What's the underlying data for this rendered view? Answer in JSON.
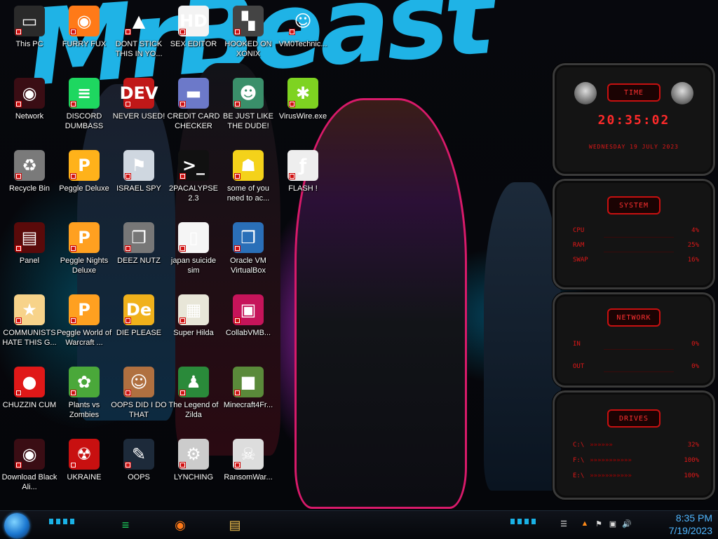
{
  "desktop": {
    "icons": [
      {
        "label": "This PC",
        "icon": "this-pc-icon",
        "bg": "#2a2a2a",
        "glyph": "▭"
      },
      {
        "label": "FURRY FUX",
        "icon": "firefox-icon",
        "bg": "#ff7a18",
        "glyph": "◉"
      },
      {
        "label": "DONT STICK THIS IN YO...",
        "icon": "vlc-cone-icon",
        "bg": "#0000",
        "glyph": "▲"
      },
      {
        "label": "SEX EDITOR",
        "icon": "hex-editor-icon",
        "bg": "#f3f3f3",
        "glyph": "HD"
      },
      {
        "label": "HOOKED ON XONIX",
        "icon": "xonix-icon",
        "bg": "#444",
        "glyph": "▚"
      },
      {
        "label": "VM0Technic...",
        "icon": "technician-icon",
        "bg": "#0000",
        "glyph": "☺"
      },
      {
        "label": "Network",
        "icon": "network-icon",
        "bg": "#3a0d14",
        "glyph": "◉"
      },
      {
        "label": "DISCORD DUMBASS",
        "icon": "spotify-icon",
        "bg": "#1ed760",
        "glyph": "≡"
      },
      {
        "label": "NEVER USED!",
        "icon": "dev-cpp-icon",
        "bg": "#c01818",
        "glyph": "DEV"
      },
      {
        "label": "CREDIT CARD CHECKER",
        "icon": "credit-card-icon",
        "bg": "#6c79c9",
        "glyph": "▬"
      },
      {
        "label": "BE JUST LIKE THE DUDE!",
        "icon": "santa-icon",
        "bg": "#3a8f6a",
        "glyph": "☻"
      },
      {
        "label": "VirusWire.exe",
        "icon": "limewire-icon",
        "bg": "#7ed321",
        "glyph": "✱"
      },
      {
        "label": "Recycle Bin",
        "icon": "recycle-bin-icon",
        "bg": "#7a7a7a",
        "glyph": "♻"
      },
      {
        "label": "Peggle Deluxe",
        "icon": "peggle-icon",
        "bg": "#ffb21a",
        "glyph": "P"
      },
      {
        "label": "ISRAEL SPY",
        "icon": "spy-icon",
        "bg": "#cfd7e0",
        "glyph": "⚑"
      },
      {
        "label": "2PACALYPSE 2.3",
        "icon": "terminal-icon",
        "bg": "#111",
        "glyph": ">_"
      },
      {
        "label": "some of you need to ac...",
        "icon": "beaver-icon",
        "bg": "#f4d21a",
        "glyph": "☗"
      },
      {
        "label": "FLASH !",
        "icon": "flash-icon",
        "bg": "#eee",
        "glyph": "ƒ"
      },
      {
        "label": "Panel",
        "icon": "control-panel-icon",
        "bg": "#5a0a0a",
        "glyph": "▤"
      },
      {
        "label": "Peggle Nights Deluxe",
        "icon": "peggle-nights-icon",
        "bg": "#ffa020",
        "glyph": "P"
      },
      {
        "label": "DEEZ NUTZ",
        "icon": "folder-stack-icon",
        "bg": "#777",
        "glyph": "❐"
      },
      {
        "label": "japan suicide sim",
        "icon": "file-icon",
        "bg": "#f5f5f5",
        "glyph": "▯"
      },
      {
        "label": "Oracle VM VirtualBox",
        "icon": "virtualbox-icon",
        "bg": "#2a6fb8",
        "glyph": "❒"
      },
      {
        "label": "COMMUNISTS HATE THIS G...",
        "icon": "star-butterfly-icon",
        "bg": "#f7d38a",
        "glyph": "★"
      },
      {
        "label": "Peggle World of Warcraft ...",
        "icon": "peggle-wow-icon",
        "bg": "#ffa020",
        "glyph": "P"
      },
      {
        "label": "DIE PLEASE",
        "icon": "de-icon",
        "bg": "#f0b11b",
        "glyph": "De"
      },
      {
        "label": "Super Hilda",
        "icon": "pixel-dog-icon",
        "bg": "#e8e6d8",
        "glyph": "▦"
      },
      {
        "label": "CollabVMB...",
        "icon": "monitor-icon",
        "bg": "#c6145a",
        "glyph": "▣"
      },
      {
        "label": "CHUZZIN CUM",
        "icon": "chuzzle-icon",
        "bg": "#e01818",
        "glyph": "●"
      },
      {
        "label": "Plants vs Zombies",
        "icon": "pvz-icon",
        "bg": "#4aa83a",
        "glyph": "✿"
      },
      {
        "label": "OOPS DID I DO THAT",
        "icon": "portrait-icon",
        "bg": "#b07040",
        "glyph": "☺"
      },
      {
        "label": "The Legend of Zilda",
        "icon": "zelda-icon",
        "bg": "#2a8a3a",
        "glyph": "♟"
      },
      {
        "label": "Minecraft4Fr...",
        "icon": "minecraft-icon",
        "bg": "#5a8a3a",
        "glyph": "■"
      },
      {
        "label": "Download Black Ali...",
        "icon": "alien-icon",
        "bg": "#3a0d14",
        "glyph": "◉"
      },
      {
        "label": "UKRAINE",
        "icon": "radiation-icon",
        "bg": "#c81010",
        "glyph": "☢"
      },
      {
        "label": "OOPS",
        "icon": "book-icon",
        "bg": "#1d2a3a",
        "glyph": "✎"
      },
      {
        "label": "LYNCHING",
        "icon": "ru-flag-icon",
        "bg": "#ccc",
        "glyph": "⚙"
      },
      {
        "label": "RansomWar...",
        "icon": "skull-icon",
        "bg": "#ddd",
        "glyph": "☠"
      }
    ],
    "wallpaper_text": "MrBeast"
  },
  "gadgets": {
    "time": {
      "title": "TIME",
      "clock": "20:35:02",
      "date": "WEDNESDAY 19 JULY 2023"
    },
    "system": {
      "title": "SYSTEM",
      "rows": [
        {
          "label": "CPU",
          "value": "4%"
        },
        {
          "label": "RAM",
          "value": "25%"
        },
        {
          "label": "SWAP",
          "value": "16%"
        }
      ]
    },
    "network": {
      "title": "NETWORK",
      "rows": [
        {
          "label": "IN",
          "value": "0%"
        },
        {
          "label": "OUT",
          "value": "0%"
        }
      ]
    },
    "drives": {
      "title": "DRIVES",
      "rows": [
        {
          "label": "C:\\",
          "value": "32%"
        },
        {
          "label": "F:\\",
          "value": "100%"
        },
        {
          "label": "E:\\",
          "value": "100%"
        }
      ]
    }
  },
  "taskbar": {
    "pinned": [
      {
        "name": "spotify-taskbar-button",
        "glyph": "≡",
        "color": "#1ed760"
      },
      {
        "name": "firefox-taskbar-button",
        "glyph": "◉",
        "color": "#ff7a18"
      },
      {
        "name": "explorer-taskbar-button",
        "glyph": "▤",
        "color": "#f2c14e"
      }
    ],
    "clock": {
      "time": "8:35 PM",
      "date": "7/19/2023"
    }
  },
  "colors": {
    "accent": "#e01818",
    "clock": "#4fb6ff",
    "brush": "#1fb3e6"
  }
}
